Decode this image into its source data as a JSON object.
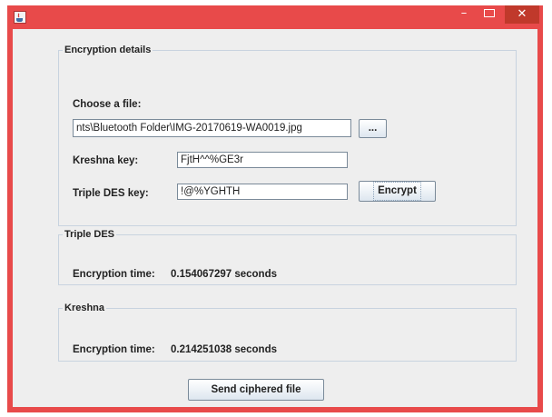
{
  "window": {
    "controls": {
      "minimize": "–",
      "close": "✕"
    }
  },
  "encryption": {
    "legend": "Encryption details",
    "choose_file_label": "Choose a file:",
    "file_path": "nts\\Bluetooth Folder\\IMG-20170619-WA0019.jpg",
    "browse_label": "...",
    "kreshna_key_label": "Kreshna key:",
    "kreshna_key_value": "FjtH^^%GE3r",
    "des_key_label": "Triple DES key:",
    "des_key_value": "!@%YGHTH",
    "encrypt_label": "Encrypt"
  },
  "triple_des": {
    "legend": "Triple DES",
    "time_label": "Encryption time:",
    "time_value": "0.154067297 seconds"
  },
  "kreshna": {
    "legend": "Kreshna",
    "time_label": "Encryption time:",
    "time_value": "0.214251038 seconds"
  },
  "send_label": "Send ciphered file",
  "colors": {
    "titlebar": "#e84a4a",
    "close_button": "#c0392b",
    "panel": "#eeeeee",
    "border": "#c8d3df"
  }
}
